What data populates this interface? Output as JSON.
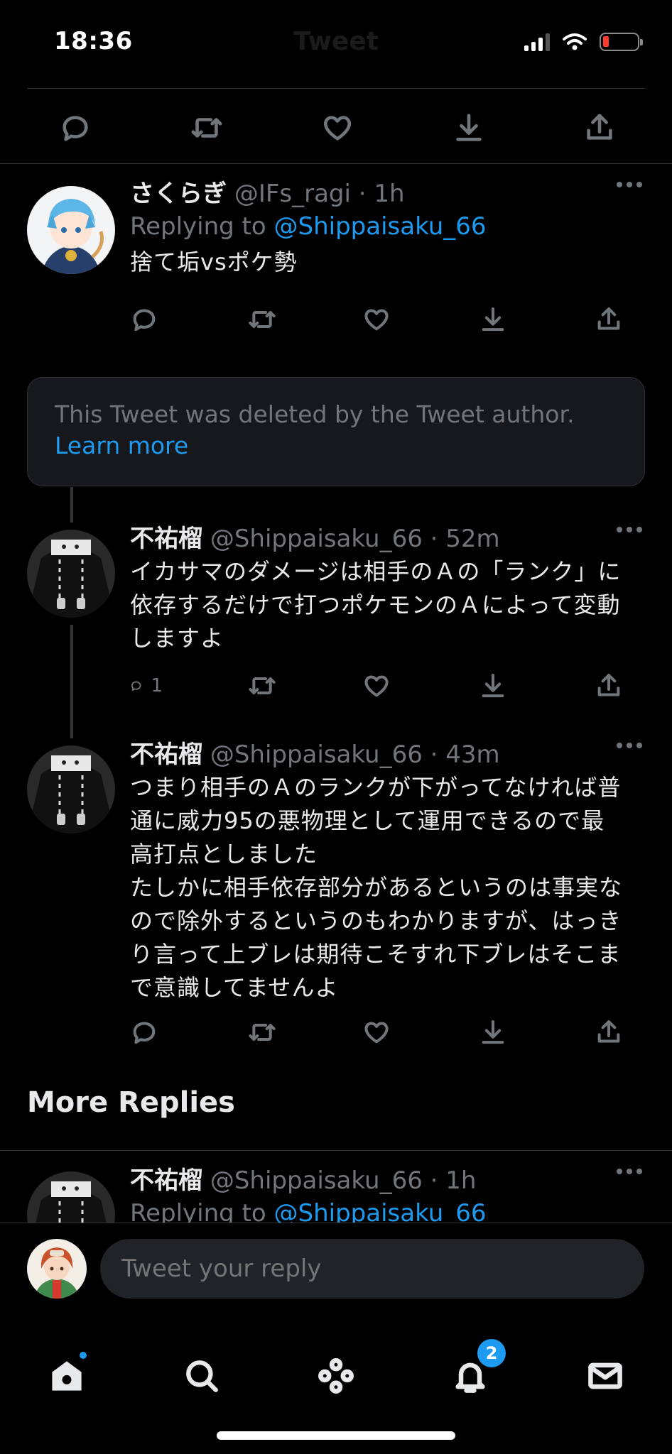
{
  "status_bar": {
    "time": "18:36",
    "title": "Tweet"
  },
  "main_actions": [
    "reply-icon",
    "retweet-icon",
    "like-icon",
    "bookmark-icon",
    "share-icon"
  ],
  "tweets": [
    {
      "name": "さくらぎ",
      "handle": "@IFs_ragi · 1h",
      "replying_prefix": "Replying to ",
      "replying_mention": "@Shippaisaku_66",
      "text": "捨て垢vsポケ勢",
      "reply_count": ""
    },
    {
      "name": "不祐榴",
      "handle": "@Shippaisaku_66 · 52m",
      "text": "イカサマのダメージは相手のＡの「ランク」に\n依存するだけで打つポケモンのＡによって変動\nしますよ",
      "reply_count": "1"
    },
    {
      "name": "不祐榴",
      "handle": "@Shippaisaku_66 · 43m",
      "text": "つまり相手のＡのランクが下がってなければ普\n通に威力95の悪物理として運用できるので最\n高打点としました\nたしかに相手依存部分があるというのは事実な\nので除外するというのもわかりますが、はっき\nり言って上ブレは期待こそすれ下ブレはそこま\nで意識してませんよ",
      "reply_count": ""
    },
    {
      "name": "不祐榴",
      "handle": "@Shippaisaku_66 · 1h",
      "replying_prefix": "Replying to ",
      "replying_mention": "@Shippaisaku_66"
    }
  ],
  "deleted_notice": {
    "text": "This Tweet was deleted by the Tweet author.",
    "link": "Learn more"
  },
  "more_replies_title": "More Replies",
  "composer": {
    "placeholder": "Tweet your reply"
  },
  "tabbar": {
    "items": [
      "home-icon",
      "search-icon",
      "spaces-icon",
      "notifications-icon",
      "messages-icon"
    ],
    "notifications_badge": "2"
  },
  "colors": {
    "accent": "#1d9bf0",
    "background": "#000000",
    "muted": "#71767b"
  }
}
